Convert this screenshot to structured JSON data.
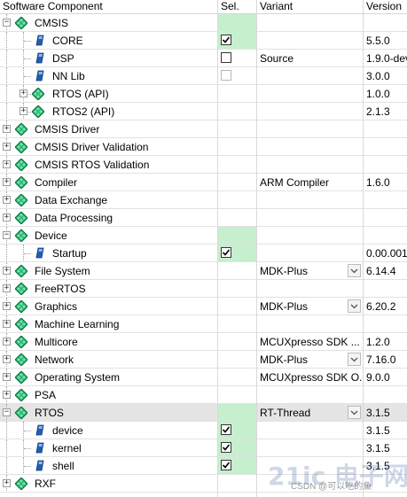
{
  "headers": {
    "component": "Software Component",
    "sel": "Sel.",
    "variant": "Variant",
    "version": "Version"
  },
  "rows": [
    {
      "name": "CMSIS",
      "level": 0,
      "icon": "diamond",
      "expander": "minus",
      "sel": null,
      "sel_green": true,
      "variant": "",
      "variant_dd": false,
      "version": ""
    },
    {
      "name": "CORE",
      "level": 1,
      "icon": "file",
      "expander": null,
      "sel": "checked",
      "sel_green": true,
      "variant": "",
      "variant_dd": false,
      "version": "5.5.0"
    },
    {
      "name": "DSP",
      "level": 1,
      "icon": "file",
      "expander": null,
      "sel": "unchecked",
      "sel_green": false,
      "variant": "Source",
      "variant_dd": false,
      "version": "1.9.0-dev"
    },
    {
      "name": "NN Lib",
      "level": 1,
      "icon": "file",
      "expander": null,
      "sel": "disabled",
      "sel_green": false,
      "variant": "",
      "variant_dd": false,
      "version": "3.0.0"
    },
    {
      "name": "RTOS (API)",
      "level": 1,
      "icon": "diamond",
      "expander": "plus",
      "sel": null,
      "sel_green": false,
      "variant": "",
      "variant_dd": false,
      "version": "1.0.0"
    },
    {
      "name": "RTOS2 (API)",
      "level": 1,
      "icon": "diamond",
      "expander": "plus",
      "sel": null,
      "sel_green": false,
      "variant": "",
      "variant_dd": false,
      "version": "2.1.3"
    },
    {
      "name": "CMSIS Driver",
      "level": 0,
      "icon": "diamond",
      "expander": "plus",
      "sel": null,
      "sel_green": false,
      "variant": "",
      "variant_dd": false,
      "version": ""
    },
    {
      "name": "CMSIS Driver Validation",
      "level": 0,
      "icon": "diamond",
      "expander": "plus",
      "sel": null,
      "sel_green": false,
      "variant": "",
      "variant_dd": false,
      "version": ""
    },
    {
      "name": "CMSIS RTOS Validation",
      "level": 0,
      "icon": "diamond",
      "expander": "plus",
      "sel": null,
      "sel_green": false,
      "variant": "",
      "variant_dd": false,
      "version": ""
    },
    {
      "name": "Compiler",
      "level": 0,
      "icon": "diamond",
      "expander": "plus",
      "sel": null,
      "sel_green": false,
      "variant": "ARM Compiler",
      "variant_dd": false,
      "version": "1.6.0"
    },
    {
      "name": "Data Exchange",
      "level": 0,
      "icon": "diamond",
      "expander": "plus",
      "sel": null,
      "sel_green": false,
      "variant": "",
      "variant_dd": false,
      "version": ""
    },
    {
      "name": "Data Processing",
      "level": 0,
      "icon": "diamond",
      "expander": "plus",
      "sel": null,
      "sel_green": false,
      "variant": "",
      "variant_dd": false,
      "version": ""
    },
    {
      "name": "Device",
      "level": 0,
      "icon": "diamond",
      "expander": "minus",
      "sel": null,
      "sel_green": true,
      "variant": "",
      "variant_dd": false,
      "version": ""
    },
    {
      "name": "Startup",
      "level": 1,
      "icon": "file",
      "expander": null,
      "sel": "checked",
      "sel_green": true,
      "variant": "",
      "variant_dd": false,
      "version": "0.00.001"
    },
    {
      "name": "File System",
      "level": 0,
      "icon": "diamond",
      "expander": "plus",
      "sel": null,
      "sel_green": false,
      "variant": "MDK-Plus",
      "variant_dd": true,
      "version": "6.14.4"
    },
    {
      "name": "FreeRTOS",
      "level": 0,
      "icon": "diamond",
      "expander": "plus",
      "sel": null,
      "sel_green": false,
      "variant": "",
      "variant_dd": false,
      "version": ""
    },
    {
      "name": "Graphics",
      "level": 0,
      "icon": "diamond",
      "expander": "plus",
      "sel": null,
      "sel_green": false,
      "variant": "MDK-Plus",
      "variant_dd": true,
      "version": "6.20.2"
    },
    {
      "name": "Machine Learning",
      "level": 0,
      "icon": "diamond",
      "expander": "plus",
      "sel": null,
      "sel_green": false,
      "variant": "",
      "variant_dd": false,
      "version": ""
    },
    {
      "name": "Multicore",
      "level": 0,
      "icon": "diamond",
      "expander": "plus",
      "sel": null,
      "sel_green": false,
      "variant": "MCUXpresso SDK ...",
      "variant_dd": false,
      "version": "1.2.0"
    },
    {
      "name": "Network",
      "level": 0,
      "icon": "diamond",
      "expander": "plus",
      "sel": null,
      "sel_green": false,
      "variant": "MDK-Plus",
      "variant_dd": true,
      "version": "7.16.0"
    },
    {
      "name": "Operating System",
      "level": 0,
      "icon": "diamond",
      "expander": "plus",
      "sel": null,
      "sel_green": false,
      "variant": "MCUXpresso SDK O...",
      "variant_dd": false,
      "version": "9.0.0"
    },
    {
      "name": "PSA",
      "level": 0,
      "icon": "diamond",
      "expander": "plus",
      "sel": null,
      "sel_green": false,
      "variant": "",
      "variant_dd": false,
      "version": ""
    },
    {
      "name": "RTOS",
      "level": 0,
      "icon": "diamond",
      "expander": "minus",
      "sel": null,
      "sel_green": true,
      "variant": "RT-Thread",
      "variant_dd": true,
      "version": "3.1.5",
      "selected": true
    },
    {
      "name": "device",
      "level": 1,
      "icon": "file",
      "expander": null,
      "sel": "checked",
      "sel_green": true,
      "variant": "",
      "variant_dd": false,
      "version": "3.1.5"
    },
    {
      "name": "kernel",
      "level": 1,
      "icon": "file",
      "expander": null,
      "sel": "checked",
      "sel_green": true,
      "variant": "",
      "variant_dd": false,
      "version": "3.1.5"
    },
    {
      "name": "shell",
      "level": 1,
      "icon": "file",
      "expander": null,
      "sel": "checked",
      "sel_green": true,
      "variant": "",
      "variant_dd": false,
      "version": "3.1.5"
    },
    {
      "name": "RXF",
      "level": 0,
      "icon": "diamond",
      "expander": "plus",
      "sel": null,
      "sel_green": false,
      "variant": "",
      "variant_dd": false,
      "version": ""
    }
  ],
  "watermark": {
    "logo_text": "21ic 电子网",
    "credit": "CSDN @可以吃的鱼"
  },
  "colors": {
    "diamond_fill": "#22b573",
    "diamond_dark": "#0b6e3d",
    "sel_green": "#c6efce",
    "file_icon": "#1f5fb4"
  }
}
